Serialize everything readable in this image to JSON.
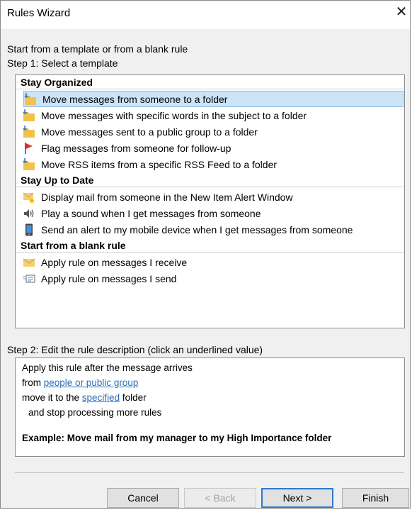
{
  "window": {
    "title": "Rules Wizard",
    "close_glyph": "✕"
  },
  "intro": "Start from a template or from a blank rule",
  "step1": "Step 1: Select a template",
  "groups": [
    {
      "header": "Stay Organized",
      "items": [
        {
          "label": "Move messages from someone to a folder",
          "icon": "move-folder-icon",
          "selected": true
        },
        {
          "label": "Move messages with specific words in the subject to a folder",
          "icon": "move-folder-icon"
        },
        {
          "label": "Move messages sent to a public group to a folder",
          "icon": "move-folder-icon"
        },
        {
          "label": "Flag messages from someone for follow-up",
          "icon": "flag-icon"
        },
        {
          "label": "Move RSS items from a specific RSS Feed to a folder",
          "icon": "move-folder-icon"
        }
      ]
    },
    {
      "header": "Stay Up to Date",
      "items": [
        {
          "label": "Display mail from someone in the New Item Alert Window",
          "icon": "new-item-alert-icon"
        },
        {
          "label": "Play a sound when I get messages from someone",
          "icon": "speaker-icon"
        },
        {
          "label": "Send an alert to my mobile device when I get messages from someone",
          "icon": "mobile-device-icon"
        }
      ]
    },
    {
      "header": "Start from a blank rule",
      "items": [
        {
          "label": "Apply rule on messages I receive",
          "icon": "envelope-icon"
        },
        {
          "label": "Apply rule on messages I send",
          "icon": "send-message-icon"
        }
      ]
    }
  ],
  "step2": "Step 2: Edit the rule description (click an underlined value)",
  "description": {
    "line1": "Apply this rule after the message arrives",
    "line2_prefix": "from ",
    "line2_link": "people or public group",
    "line3_prefix": "move it to the ",
    "line3_link": "specified",
    "line3_suffix": " folder",
    "line4": "and stop processing more rules",
    "example": "Example: Move mail from my manager to my High Importance folder"
  },
  "buttons": {
    "cancel": "Cancel",
    "back": "< Back",
    "next": "Next >",
    "finish": "Finish"
  },
  "colors": {
    "selection": "#cce4f7",
    "link": "#2a6ebc",
    "folder": "#f2c14e",
    "flag": "#d9302c",
    "arrow": "#2f7fd1"
  }
}
